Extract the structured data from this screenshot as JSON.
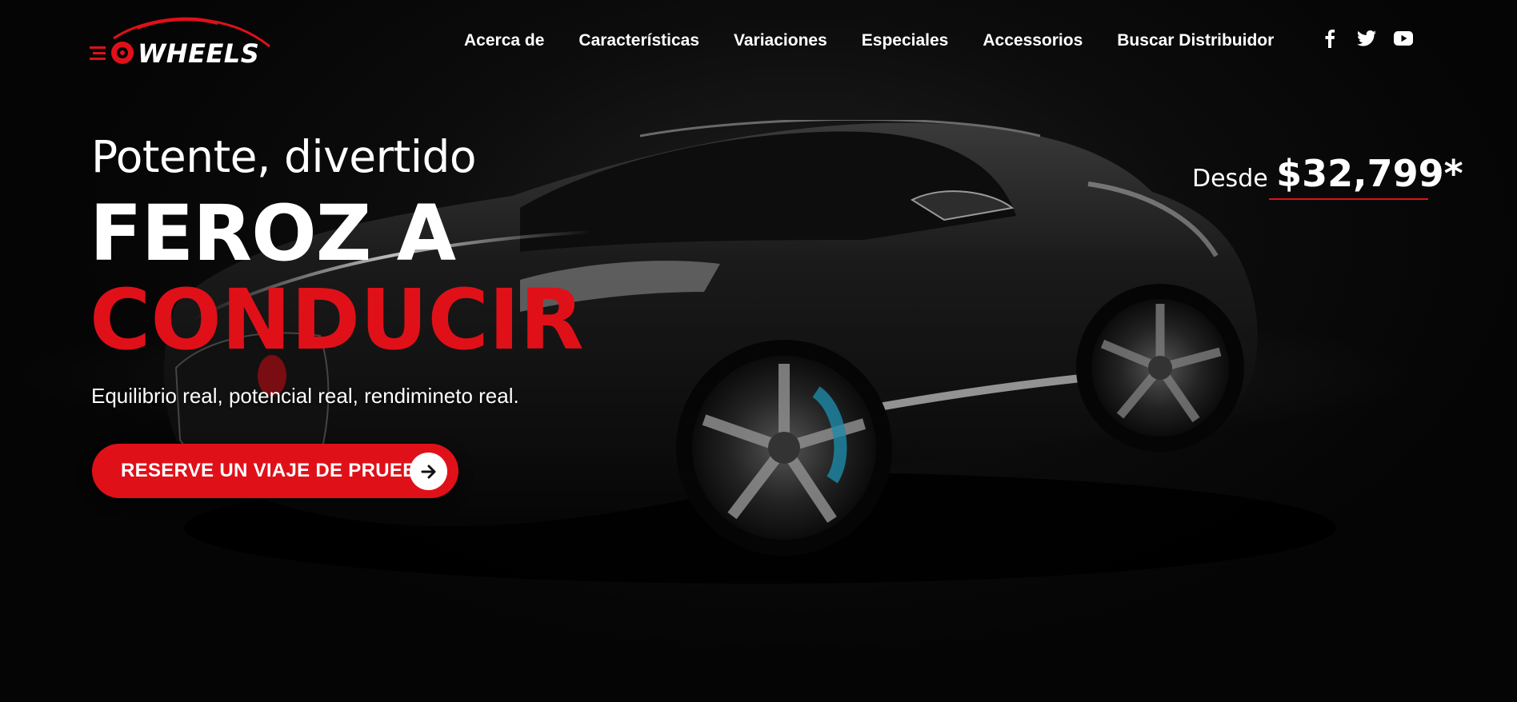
{
  "brand": {
    "name": "WHEELS",
    "logo_icon": "car-wheel-logo",
    "accent": "#e01019"
  },
  "nav": {
    "items": [
      {
        "label": "Acerca de"
      },
      {
        "label": "Características"
      },
      {
        "label": "Variaciones"
      },
      {
        "label": "Especiales"
      },
      {
        "label": "Accessorios"
      },
      {
        "label": "Buscar Distribuidor"
      }
    ]
  },
  "social": [
    {
      "icon": "facebook-icon"
    },
    {
      "icon": "twitter-icon"
    },
    {
      "icon": "youtube-icon"
    }
  ],
  "hero": {
    "subtitle": "Potente, divertido",
    "headline_line1": "FEROZ A",
    "headline_line2": "CONDUCIR",
    "tagline": "Equilibrio real, potencial real, rendimineto real.",
    "cta_label": "RESERVE UN VIAJE DE PRUEBA",
    "cta_icon": "arrow-right-icon",
    "price_prefix": "Desde",
    "price_value": "$32,799*",
    "image": "black-sports-car"
  }
}
